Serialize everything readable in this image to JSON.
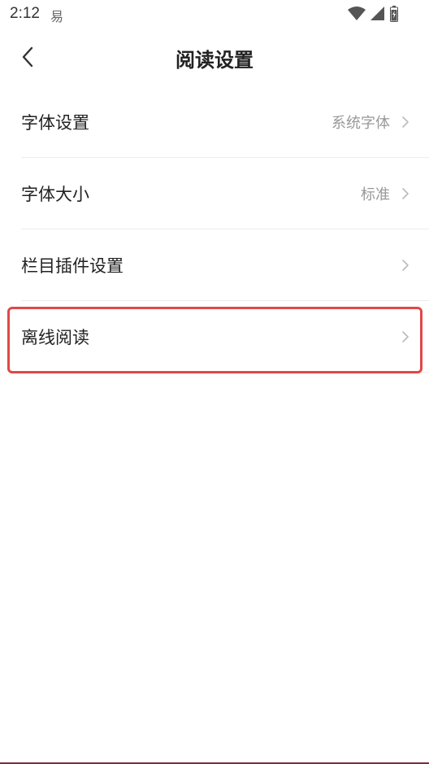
{
  "status_bar": {
    "time": "2:12",
    "app_icon_glyph": "易",
    "icons": [
      "wifi-icon",
      "signal-icon",
      "battery-icon"
    ]
  },
  "header": {
    "title": "阅读设置",
    "back_icon": "chevron-left-icon"
  },
  "settings": {
    "items": [
      {
        "label": "字体设置",
        "value": "系统字体"
      },
      {
        "label": "字体大小",
        "value": "标准"
      },
      {
        "label": "栏目插件设置",
        "value": ""
      },
      {
        "label": "离线阅读",
        "value": ""
      }
    ]
  },
  "colors": {
    "highlight": "#e04848",
    "text_primary": "#222222",
    "text_secondary": "#999999",
    "divider": "#ececec"
  }
}
